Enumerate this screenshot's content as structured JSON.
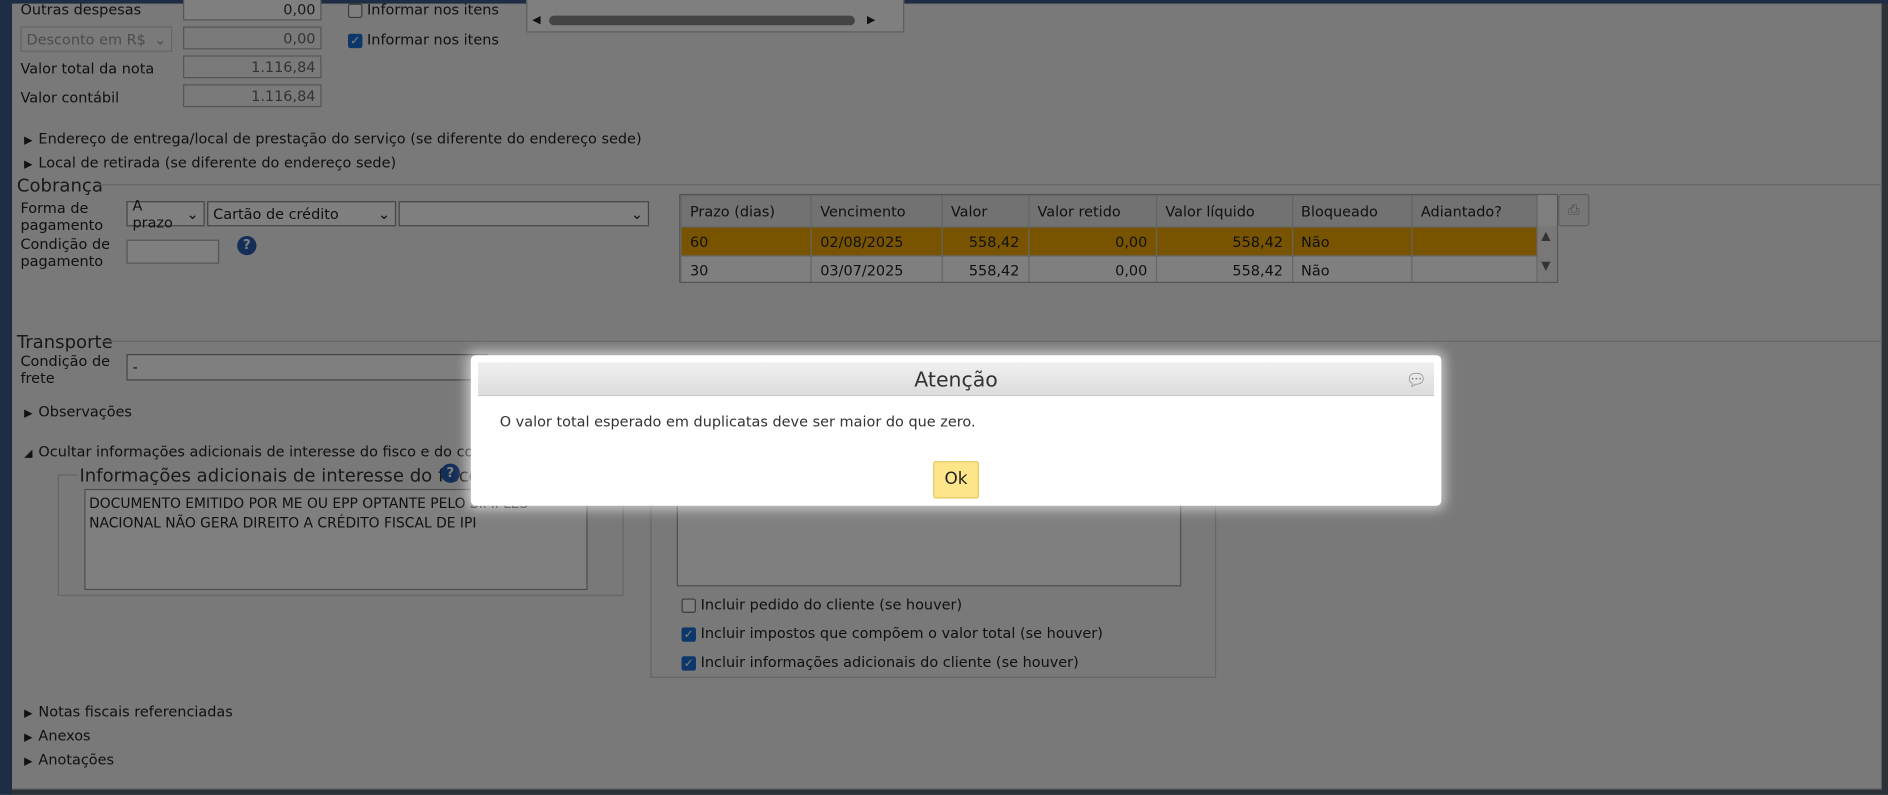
{
  "totals": {
    "outras_despesas_label": "Outras despesas",
    "outras_despesas_value": "0,00",
    "desconto_select": "Desconto em R$",
    "desconto_value": "0,00",
    "valor_total_label": "Valor total da nota",
    "valor_total_value": "1.116,84",
    "valor_contabil_label": "Valor contábil",
    "valor_contabil_value": "1.116,84",
    "informar_itens_1": "Informar nos itens",
    "informar_itens_2": "Informar nos itens",
    "informar_itens_1_checked": false,
    "informar_itens_2_checked": true
  },
  "expanders": {
    "endereco_entrega": "Endereço de entrega/local de prestação do serviço (se diferente do endereço sede)",
    "local_retirada": "Local de retirada (se diferente do endereço sede)"
  },
  "cobranca": {
    "title": "Cobrança",
    "forma_label": "Forma de pagamento",
    "forma_select": "A prazo",
    "meio_select": "Cartão de crédito",
    "extra_select": "",
    "condicao_label": "Condição de pagamento",
    "condicao_value": "",
    "table": {
      "headers": [
        "Prazo (dias)",
        "Vencimento",
        "Valor",
        "Valor retido",
        "Valor líquido",
        "Bloqueado",
        "Adiantado?"
      ],
      "rows": [
        [
          "60",
          "02/08/2025",
          "558,42",
          "0,00",
          "558,42",
          "Não",
          ""
        ],
        [
          "30",
          "03/07/2025",
          "558,42",
          "0,00",
          "558,42",
          "Não",
          ""
        ]
      ],
      "selected_row": 0,
      "selected_color": "#f2a900"
    }
  },
  "transporte": {
    "title": "Transporte",
    "frete_label": "Condição de frete",
    "frete_value": "-",
    "observacoes": "Observações",
    "ocultar": "Ocultar informações adicionais de interesse do fisco e do contribuinte",
    "fisco_title": "Informações adicionais de interesse do fisco",
    "fisco_text": "DOCUMENTO EMITIDO POR ME OU EPP OPTANTE PELO SIMPLES NACIONAL NÃO GERA DIREITO A CRÉDITO FISCAL DE IPI",
    "incluir_pedido": "Incluir pedido do cliente (se houver)",
    "incluir_impostos": "Incluir impostos que compõem o valor total (se houver)",
    "incluir_info": "Incluir informações adicionais do cliente (se houver)"
  },
  "bottom": {
    "notas": "Notas fiscais referenciadas",
    "anexos": "Anexos",
    "anotacoes": "Anotações"
  },
  "dialog": {
    "title": "Atenção",
    "message": "O valor total esperado em duplicatas deve ser maior do que zero.",
    "ok": "Ok"
  }
}
